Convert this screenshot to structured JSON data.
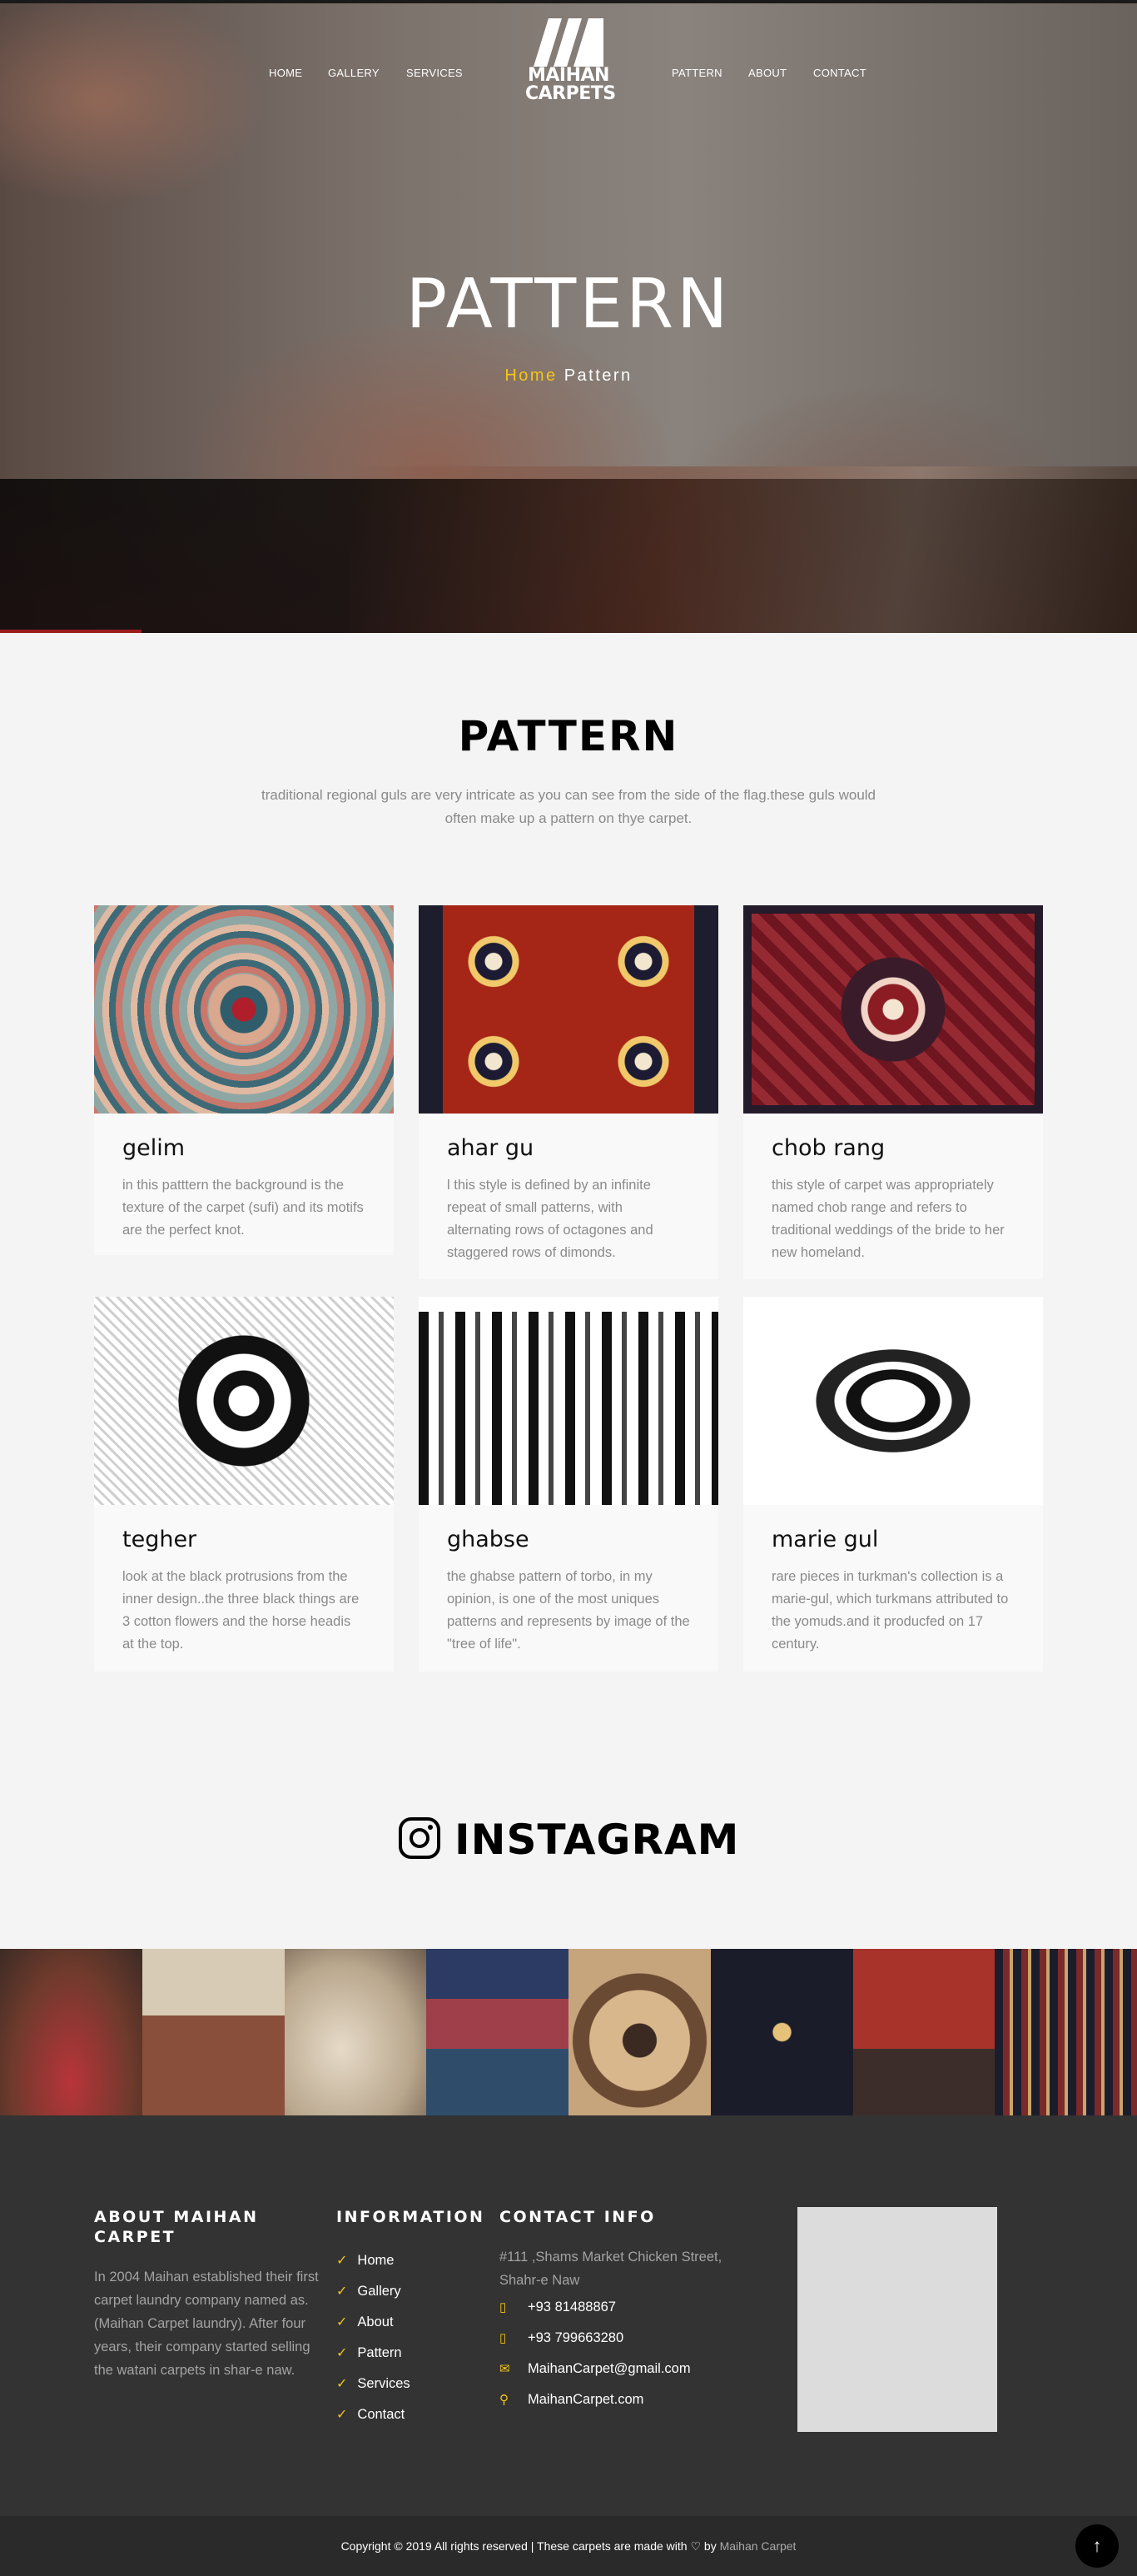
{
  "nav": {
    "left": [
      "HOME",
      "GALLERY",
      "SERVICES"
    ],
    "right": [
      "PATTERN",
      "ABOUT",
      "CONTACT"
    ],
    "logo_line1": "MAIHAN",
    "logo_line2": "CARPETS"
  },
  "hero": {
    "title": "PATTERN",
    "breadcrumb_home": "Home",
    "breadcrumb_current": "Pattern"
  },
  "pattern_section": {
    "title": "PATTERN",
    "description": "traditional regional guls are very intricate as you can see from the side of the flag.these guls would often make up a pattern on thye carpet."
  },
  "cards": [
    {
      "title": "gelim",
      "text": "in this patttern the background is the texture of the carpet (sufi) and its motifs are the perfect knot."
    },
    {
      "title": "ahar gu",
      "text": "l this style is defined by an infinite repeat of small patterns, with alternating rows of octagones and staggered rows of dimonds."
    },
    {
      "title": "chob rang",
      "text": "this style of carpet was appropriately named chob range and refers to traditional weddings of the bride to her new homeland."
    },
    {
      "title": "tegher",
      "text": "look at the black protrusions from the inner design..the three black things are 3 cotton flowers and the horse headis at the top."
    },
    {
      "title": "ghabse",
      "text": "the ghabse pattern of torbo, in my opinion, is one of the most uniques patterns and represents by image of the \"tree of life\"."
    },
    {
      "title": "marie gul",
      "text": "rare pieces in turkman's collection is a marie-gul, which turkmans attributed to the yomuds.and it producfed on 17 century."
    }
  ],
  "instagram": {
    "title": "INSTAGRAM"
  },
  "footer": {
    "about_title": "ABOUT MAIHAN CARPET",
    "about_text": "In 2004 Maihan established their first carpet laundry company named as. (Maihan Carpet laundry). After four years, their company started selling the watani carpets in shar-e naw.",
    "info_title": "INFORMATION",
    "info_links": [
      "Home",
      "Gallery",
      "About",
      "Pattern",
      "Services",
      "Contact"
    ],
    "contact_title": "CONTACT INFO",
    "address": "#111 ,Shams Market Chicken Street, Shahr-e Naw",
    "phone1": "+93 81488867",
    "phone2": "+93 799663280",
    "email": "MaihanCarpet@gmail.com",
    "website": "MaihanCarpet.com"
  },
  "copyright": {
    "text": "Copyright © 2019 All rights reserved | These carpets are made with",
    "by": "by",
    "brand": "Maihan Carpet"
  },
  "icons": {
    "check": "check-icon",
    "phone": "phone-icon",
    "email": "envelope-icon",
    "location": "map-pin-icon",
    "instagram": "instagram-icon",
    "heart": "heart-icon",
    "totop": "arrow-up-icon"
  },
  "colors": {
    "accent_yellow": "#f5c518",
    "footer_bg": "#333333",
    "bottombar_bg": "#2a2a2a"
  }
}
